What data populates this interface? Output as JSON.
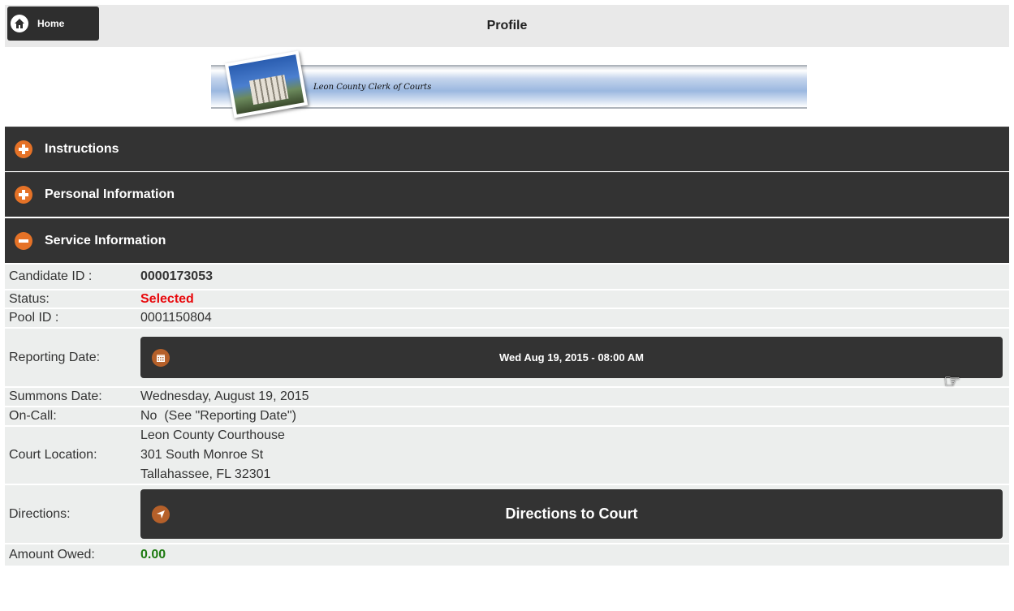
{
  "header": {
    "home_label": "Home",
    "title": "Profile"
  },
  "banner": {
    "text": "Leon County Clerk of Courts"
  },
  "accordion": [
    {
      "label": "Instructions",
      "state": "collapsed"
    },
    {
      "label": "Personal Information",
      "state": "collapsed"
    },
    {
      "label": "Service Information",
      "state": "expanded"
    }
  ],
  "service": {
    "candidate_id_label": "Candidate ID :",
    "candidate_id": "0000173053",
    "status_label": "Status:",
    "status": "Selected",
    "pool_id_label": "Pool ID :",
    "pool_id": "0001150804",
    "reporting_date_label": "Reporting Date:",
    "reporting_date": "Wed Aug 19, 2015 - 08:00 AM",
    "summons_date_label": "Summons Date:",
    "summons_date": "Wednesday, August 19, 2015",
    "on_call_label": "On-Call:",
    "on_call": "No  (See \"Reporting Date\")",
    "court_location_label": "Court Location:",
    "court_location": [
      "Leon County Courthouse",
      "301 South Monroe St",
      "Tallahassee, FL 32301"
    ],
    "directions_label": "Directions:",
    "directions_button": "Directions to Court",
    "amount_owed_label": "Amount Owed:",
    "amount_owed": "0.00"
  },
  "colors": {
    "accent": "#e57227",
    "status_red": "#e8070b",
    "amount_green": "#1d7a10",
    "bar_dark": "#333333"
  }
}
